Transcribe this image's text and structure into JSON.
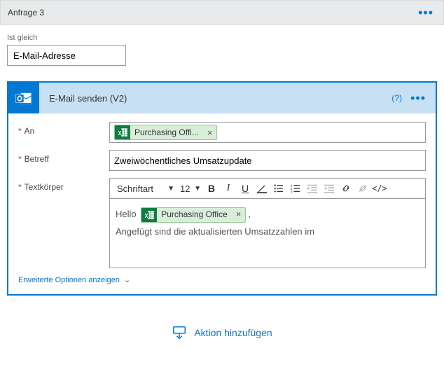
{
  "header": {
    "title": "Anfrage 3"
  },
  "condition": {
    "operator_label": "Ist gleich",
    "value": "E-Mail-Adresse"
  },
  "action": {
    "title": "E-Mail senden (V2)",
    "help_text": "(?)",
    "fields": {
      "to_label": "An",
      "to_chip": "Purchasing Offi...",
      "subject_label": "Betreff",
      "subject_value": "Zweiwöchentliches Umsatzupdate",
      "body_label": "Textkörper",
      "font_family": "Schriftart",
      "font_size": "12",
      "body_hello": "Hello",
      "body_chip": "Purchasing Office",
      "body_text_line2": "Angefügt sind die aktualisierten Umsatzzahlen im"
    },
    "show_advanced": "Erweiterte Optionen anzeigen"
  },
  "add_action": "Aktion hinzufügen"
}
